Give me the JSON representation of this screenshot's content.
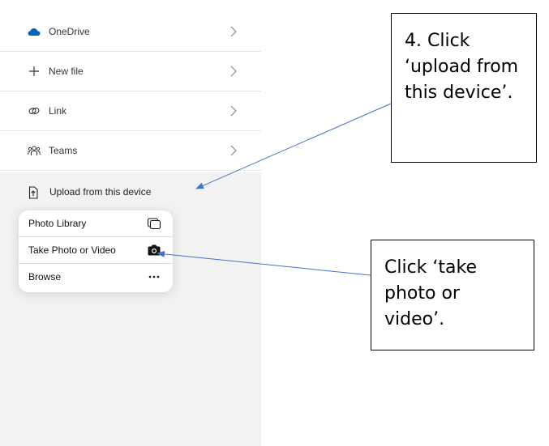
{
  "share_list": {
    "items": [
      {
        "label": "OneDrive",
        "icon": "cloud-icon"
      },
      {
        "label": "New file",
        "icon": "plus-icon"
      },
      {
        "label": "Link",
        "icon": "link-icon"
      },
      {
        "label": "Teams",
        "icon": "teams-icon"
      }
    ],
    "upload": {
      "label": "Upload from this device",
      "icon": "upload-device-icon"
    }
  },
  "upload_menu": {
    "items": [
      {
        "label": "Photo Library",
        "icon": "photo-library-icon"
      },
      {
        "label": "Take Photo or Video",
        "icon": "camera-icon"
      },
      {
        "label": "Browse",
        "icon": "ellipsis-icon"
      }
    ]
  },
  "annotations": {
    "callout_1": "4. Click ‘upload from this device’.",
    "callout_2": "Click ‘take photo or video’."
  },
  "colors": {
    "onedrive_blue": "#0364B8",
    "arrow_blue": "#4472C4",
    "panel_gray": "#F2F2F2"
  }
}
